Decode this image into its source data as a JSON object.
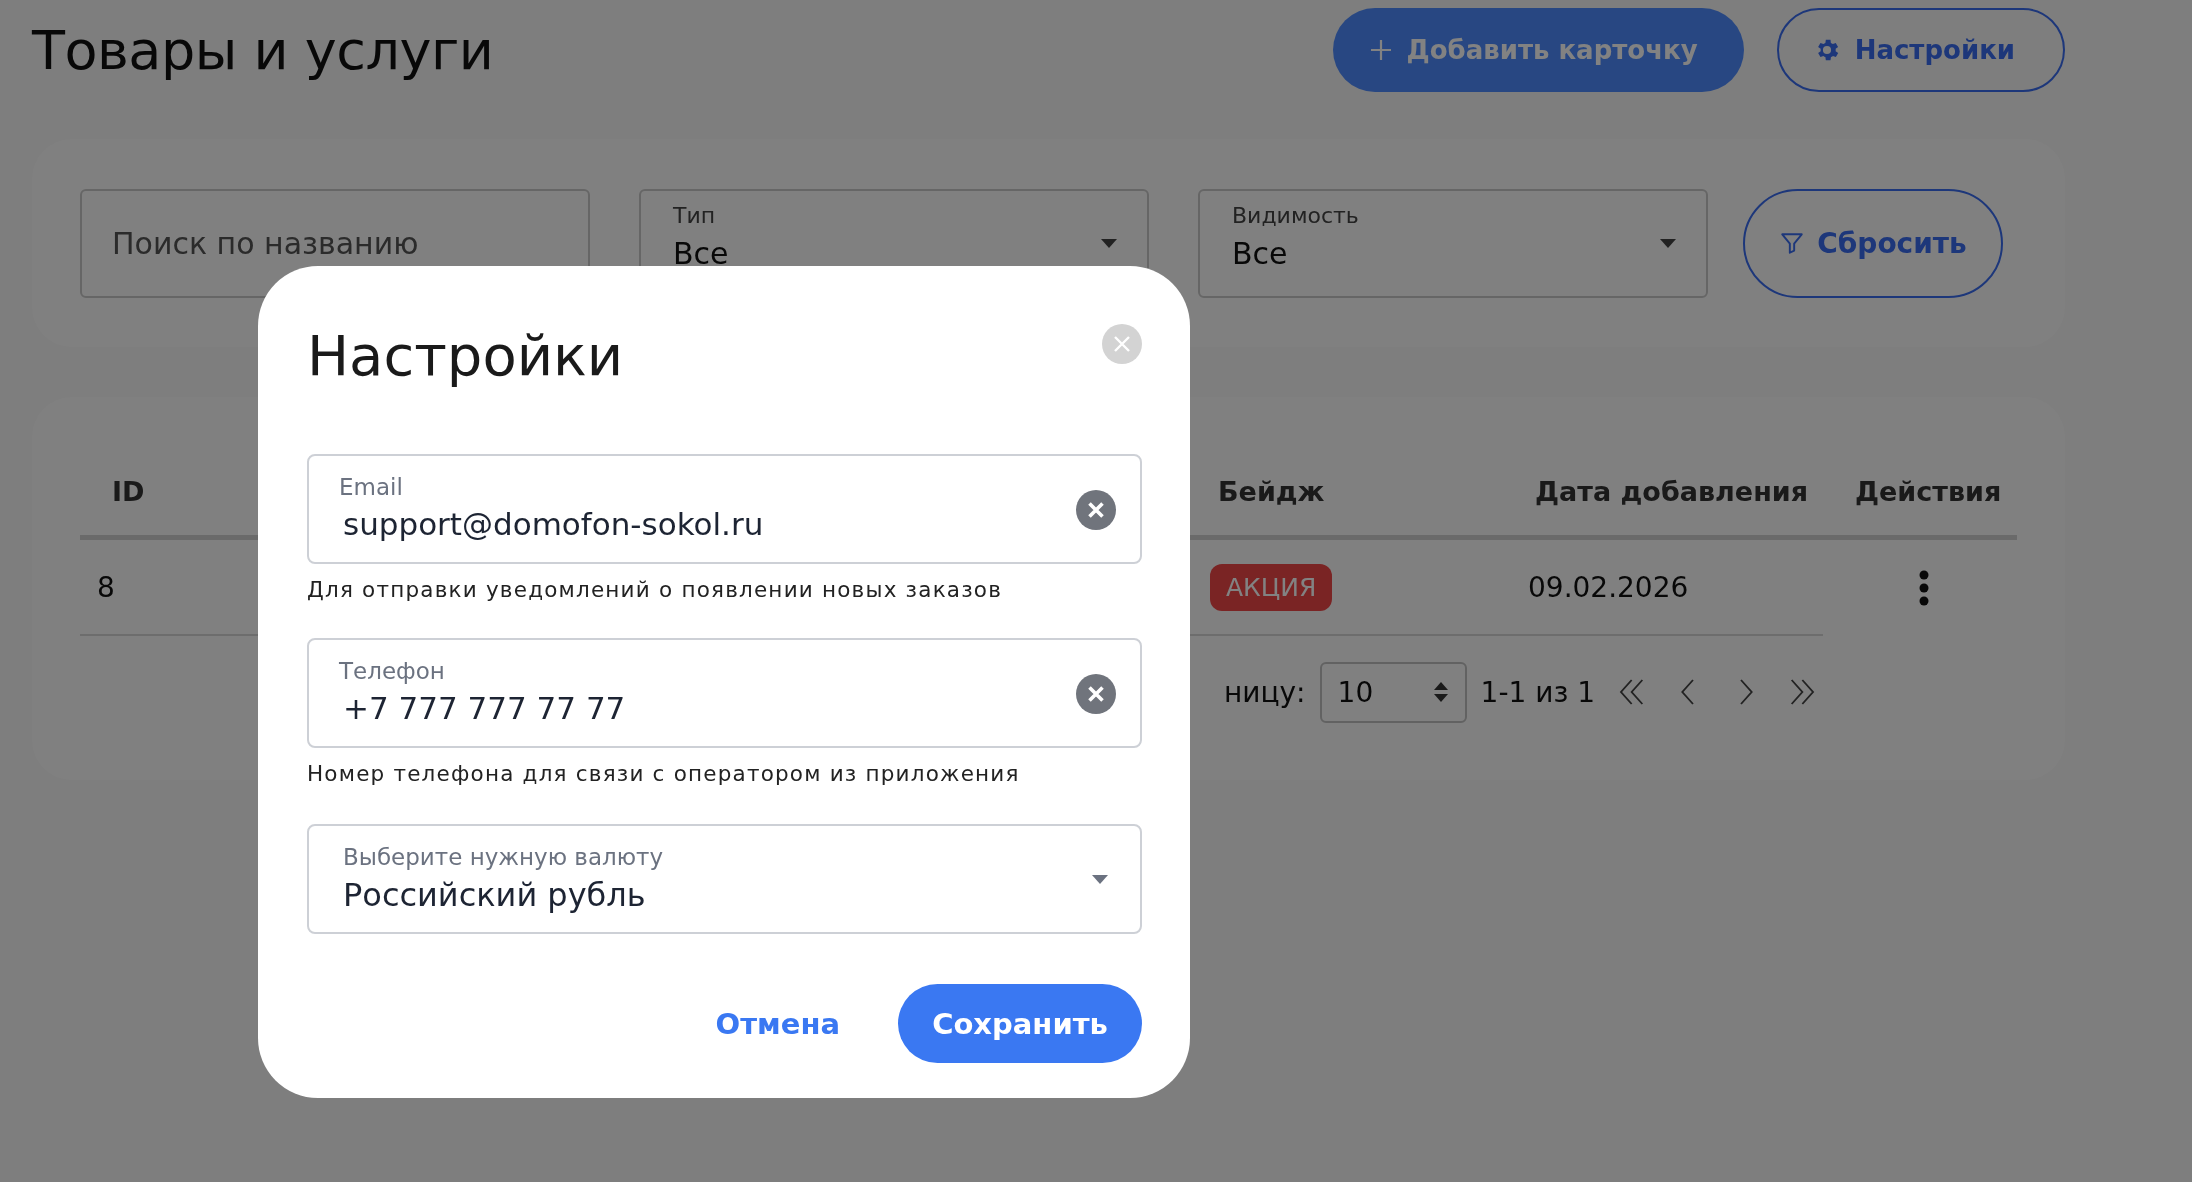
{
  "page": {
    "title": "Товары и услуги",
    "actions": [
      {
        "label": "Добавить карточку",
        "kind": "primary"
      },
      {
        "label": "Настройки",
        "kind": "outline"
      }
    ]
  },
  "filters": {
    "search": {
      "placeholder": "Поиск по названию"
    },
    "selects": [
      {
        "label": "Тип",
        "value": "Все"
      },
      {
        "label": "Видимость",
        "value": "Все"
      }
    ],
    "reset": "Сбросить"
  },
  "table": {
    "columns": [
      {
        "label": "ID"
      },
      {
        "label": "Бейдж"
      },
      {
        "label": "Дата добавления"
      },
      {
        "label": "Действия"
      }
    ],
    "rows": [
      {
        "id": "8",
        "badge": "АКЦИЯ",
        "date": "09.02.2026"
      }
    ]
  },
  "pagination": {
    "rows_label": "ницу:",
    "per_page": "10",
    "range": "1-1 из 1"
  },
  "dialog": {
    "title": "Настройки",
    "fields": [
      {
        "kind": "text",
        "label": "Email",
        "value": "support@domofon-sokol.ru",
        "helper": "Для отправки уведомлений о появлении новых заказов"
      },
      {
        "kind": "text",
        "label": "Телефон",
        "value": "+7 777 777 77 77",
        "helper": "Номер телефона для связи с оператором из приложения"
      },
      {
        "kind": "select",
        "label": "Выберите нужную валюту",
        "value": "Российский рубль"
      }
    ],
    "buttons": [
      {
        "label": "Отмена",
        "kind": "text"
      },
      {
        "label": "Сохранить",
        "kind": "primary"
      }
    ]
  }
}
